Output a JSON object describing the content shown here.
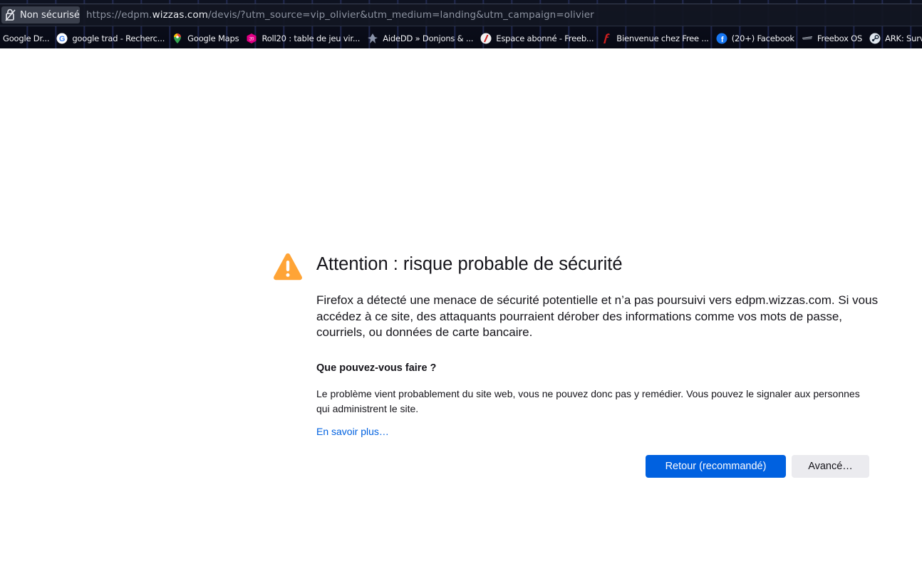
{
  "browser": {
    "identity_label": "Non sécurisé",
    "url": {
      "prefix": "https://edpm.",
      "host": "wizzas.com",
      "suffix": "/devis/?utm_source=vip_olivier&utm_medium=landing&utm_campaign=olivier"
    },
    "bookmarks": [
      {
        "label": "Google Dr...",
        "icon": "drive-icon"
      },
      {
        "label": "google trad - Recherc...",
        "icon": "google-icon"
      },
      {
        "label": "Google Maps",
        "icon": "maps-pin-icon"
      },
      {
        "label": "Roll20 : table de jeu vir...",
        "icon": "roll20-icon"
      },
      {
        "label": "AideDD » Donjons & ...",
        "icon": "aidedd-icon"
      },
      {
        "label": "Espace abonné - Freeb...",
        "icon": "free-icon"
      },
      {
        "label": "Bienvenue chez Free ...",
        "icon": "free-f-icon"
      },
      {
        "label": "(20+) Facebook",
        "icon": "facebook-icon"
      },
      {
        "label": "Freebox OS",
        "icon": "freebox-icon"
      },
      {
        "label": "ARK: Survival Evo",
        "icon": "steam-icon"
      }
    ]
  },
  "error": {
    "title": "Attention : risque probable de sécurité",
    "description": "Firefox a détecté une menace de sécurité potentielle et n’a pas poursuivi vers edpm.wizzas.com. Si vous accédez à ce site, des attaquants pourraient dérober des informations comme vos mots de passe, courriels, ou données de carte bancaire.",
    "subheading": "Que pouvez-vous faire ?",
    "help_text": "Le problème vient probablement du site web, vous ne pouvez donc pas y remédier. Vous pouvez le signaler aux personnes qui administrent le site.",
    "learn_more": "En savoir plus…",
    "primary_button": "Retour (recommandé)",
    "secondary_button": "Avancé…"
  },
  "colors": {
    "warning": "#ffa436",
    "primary_button": "#0061e0",
    "link": "#0061e0",
    "secondary_button": "#ebebef"
  }
}
